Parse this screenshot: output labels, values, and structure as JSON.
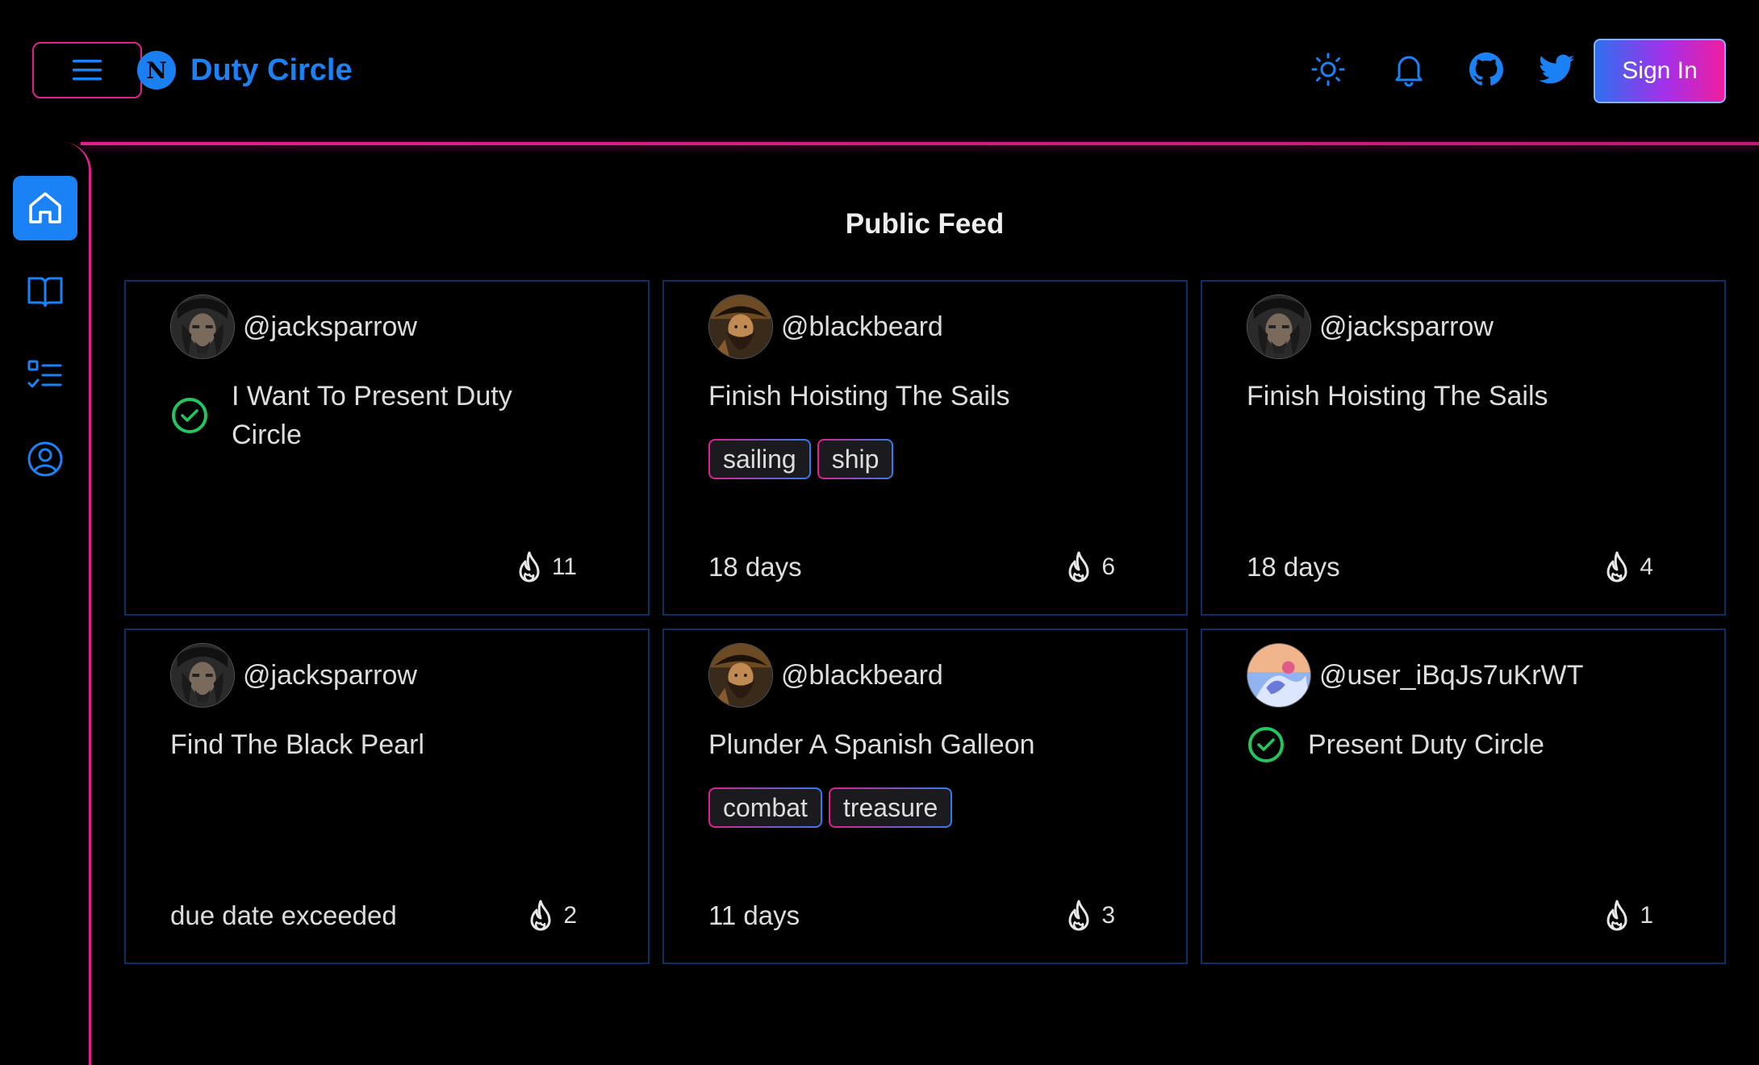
{
  "app": {
    "brand_logo_letter": "N",
    "brand_name": "Duty Circle",
    "sign_in_label": "Sign In"
  },
  "colors": {
    "accent": "#1b82f5",
    "pink": "#e0208c",
    "card_border": "#0e2f63",
    "check_green": "#22c55e"
  },
  "header_icons": [
    "menu-icon",
    "sun-icon",
    "bell-icon",
    "github-icon",
    "twitter-icon"
  ],
  "sidebar": {
    "items": [
      {
        "name": "home",
        "icon": "home-icon",
        "active": true
      },
      {
        "name": "book",
        "icon": "book-icon",
        "active": false
      },
      {
        "name": "tasks",
        "icon": "tasks-list-icon",
        "active": false
      },
      {
        "name": "profile",
        "icon": "user-circle-icon",
        "active": false
      }
    ]
  },
  "feed": {
    "title": "Public Feed",
    "cards": [
      {
        "username": "@jacksparrow",
        "avatar": "jacksparrow",
        "task": "I Want To Present Duty Circle",
        "completed": true,
        "tags": [],
        "due": "",
        "fire": "11"
      },
      {
        "username": "@blackbeard",
        "avatar": "blackbeard",
        "task": "Finish Hoisting The Sails",
        "completed": false,
        "tags": [
          "sailing",
          "ship"
        ],
        "due": "18 days",
        "fire": "6"
      },
      {
        "username": "@jacksparrow",
        "avatar": "jacksparrow",
        "task": "Finish Hoisting The Sails",
        "completed": false,
        "tags": [],
        "due": "18 days",
        "fire": "4"
      },
      {
        "username": "@jacksparrow",
        "avatar": "jacksparrow",
        "task": "Find The Black Pearl",
        "completed": false,
        "tags": [],
        "due": "due date exceeded",
        "fire": "2"
      },
      {
        "username": "@blackbeard",
        "avatar": "blackbeard",
        "task": "Plunder A Spanish Galleon",
        "completed": false,
        "tags": [
          "combat",
          "treasure"
        ],
        "due": "11 days",
        "fire": "3"
      },
      {
        "username": "@user_iBqJs7uKrWT",
        "avatar": "generic",
        "task": "Present Duty Circle",
        "completed": true,
        "tags": [],
        "due": "",
        "fire": "1"
      }
    ]
  }
}
